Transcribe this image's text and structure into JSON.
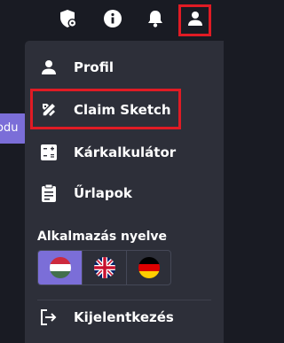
{
  "background_chip": {
    "text": "odu"
  },
  "topbar": {
    "icons": [
      "shield-gear-icon",
      "info-icon",
      "bell-icon",
      "user-icon"
    ]
  },
  "menu": {
    "items": [
      {
        "label": "Profil",
        "icon": "user-icon"
      },
      {
        "label": "Claim Sketch",
        "icon": "tools-icon",
        "highlighted": true
      },
      {
        "label": "Kárkalkulátor",
        "icon": "calculator-icon"
      },
      {
        "label": "Űrlapok",
        "icon": "clipboard-icon"
      }
    ],
    "language": {
      "title": "Alkalmazás nyelve",
      "options": [
        {
          "flag": "hungary-flag-icon",
          "selected": true
        },
        {
          "flag": "uk-flag-icon",
          "selected": false
        },
        {
          "flag": "germany-flag-icon",
          "selected": false
        }
      ]
    },
    "logout": {
      "label": "Kijelentkezés",
      "icon": "logout-icon"
    }
  },
  "colors": {
    "background": "#191b23",
    "menu": "#2d2f39",
    "accent": "#7b6ed8",
    "highlight_border": "#e01b24",
    "text": "#ffffff"
  }
}
